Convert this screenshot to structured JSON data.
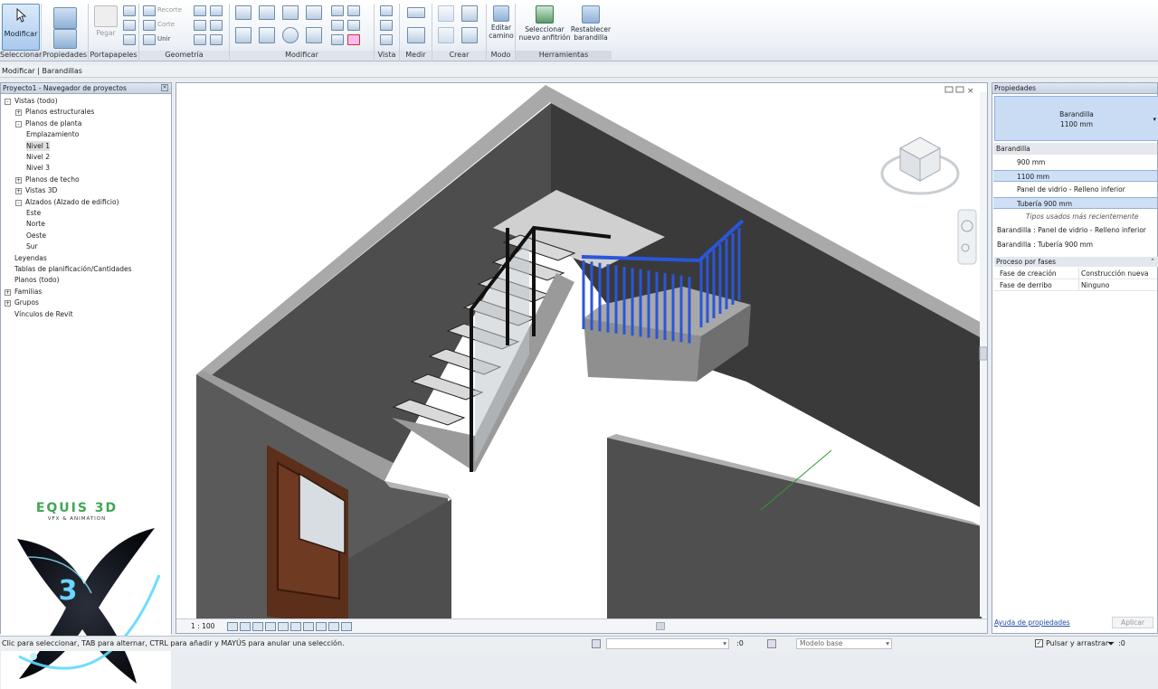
{
  "ribbon": {
    "modify_label": "Modificar",
    "groups": {
      "select": "Seleccionar",
      "properties": "Propiedades",
      "clipboard": "Portapapeles",
      "geometry": "Geometría",
      "modify": "Modificar",
      "view": "Vista",
      "measure": "Medir",
      "create": "Crear",
      "mode": "Modo",
      "tools": "Herramientas"
    },
    "buttons": {
      "paste": "Pegar",
      "cut_geom": "Recorte",
      "cut": "Corte",
      "join": "Unir",
      "edit_path_1": "Editar",
      "edit_path_2": "camino",
      "select_host_1": "Seleccionar",
      "select_host_2": "nuevo anfitrión",
      "reset_railing_1": "Restablecer",
      "reset_railing_2": "barandilla"
    }
  },
  "context_bar": "Modificar | Barandillas",
  "project_browser": {
    "title": "Proyecto1 - Navegador de proyectos",
    "items": [
      {
        "label": "Vistas (todo)",
        "level": 0,
        "toggle": "-"
      },
      {
        "label": "Planos estructurales",
        "level": 1,
        "toggle": "+"
      },
      {
        "label": "Planos de planta",
        "level": 1,
        "toggle": "-"
      },
      {
        "label": "Emplazamiento",
        "level": 2,
        "toggle": ""
      },
      {
        "label": "Nivel 1",
        "level": 2,
        "toggle": ""
      },
      {
        "label": "Nivel 2",
        "level": 2,
        "toggle": ""
      },
      {
        "label": "Nivel 3",
        "level": 2,
        "toggle": ""
      },
      {
        "label": "Planos de techo",
        "level": 1,
        "toggle": "+"
      },
      {
        "label": "Vistas 3D",
        "level": 1,
        "toggle": "+"
      },
      {
        "label": "Alzados (Alzado de edificio)",
        "level": 1,
        "toggle": "-"
      },
      {
        "label": "Este",
        "level": 2,
        "toggle": ""
      },
      {
        "label": "Norte",
        "level": 2,
        "toggle": ""
      },
      {
        "label": "Oeste",
        "level": 2,
        "toggle": ""
      },
      {
        "label": "Sur",
        "level": 2,
        "toggle": ""
      },
      {
        "label": "Leyendas",
        "level": 0,
        "toggle": ""
      },
      {
        "label": "Tablas de planificación/Cantidades",
        "level": 0,
        "toggle": ""
      },
      {
        "label": "Planos (todo)",
        "level": 0,
        "toggle": ""
      },
      {
        "label": "Familias",
        "level": 0,
        "toggle": "+"
      },
      {
        "label": "Grupos",
        "level": 0,
        "toggle": "+"
      },
      {
        "label": "Vínculos de Revit",
        "level": 0,
        "toggle": ""
      }
    ],
    "selected_index": 4
  },
  "logo": {
    "brand": "EQUIS 3D",
    "tagline": "VFX & ANIMATION",
    "numeral": "3"
  },
  "view": {
    "scale": "1 : 100"
  },
  "properties": {
    "title": "Propiedades",
    "type_name_1": "Barandilla",
    "type_name_2": "1100 mm",
    "dropdown": {
      "family": "Barandilla",
      "options": [
        "900 mm",
        "1100 mm",
        "Panel de vidrio - Relleno inferior",
        "Tubería 900 mm"
      ],
      "selected": "1100 mm",
      "recent_header": "Tipos usados más recientemente",
      "recent": [
        "Barandilla : Panel de vidrio - Relleno inferior",
        "Barandilla : Tubería 900 mm"
      ]
    },
    "section": "Proceso por fases",
    "rows": [
      {
        "name": "Fase de creación",
        "value": "Construcción nueva"
      },
      {
        "name": "Fase de derribo",
        "value": "Ninguno"
      }
    ],
    "help_link": "Ayuda de propiedades",
    "apply": "Aplicar"
  },
  "status": {
    "message": "Clic para seleccionar, TAB para alternar, CTRL para añadir y MAYÚS para anular una selección.",
    "coord": ":0",
    "model": "Modelo base",
    "drag": "Pulsar y arrastrar",
    "filter": ":0"
  },
  "colors": {
    "selection_blue": "#2a56d8",
    "ribbon_bg": "#eef2f7",
    "wall_gray": "#4a4a4a"
  }
}
